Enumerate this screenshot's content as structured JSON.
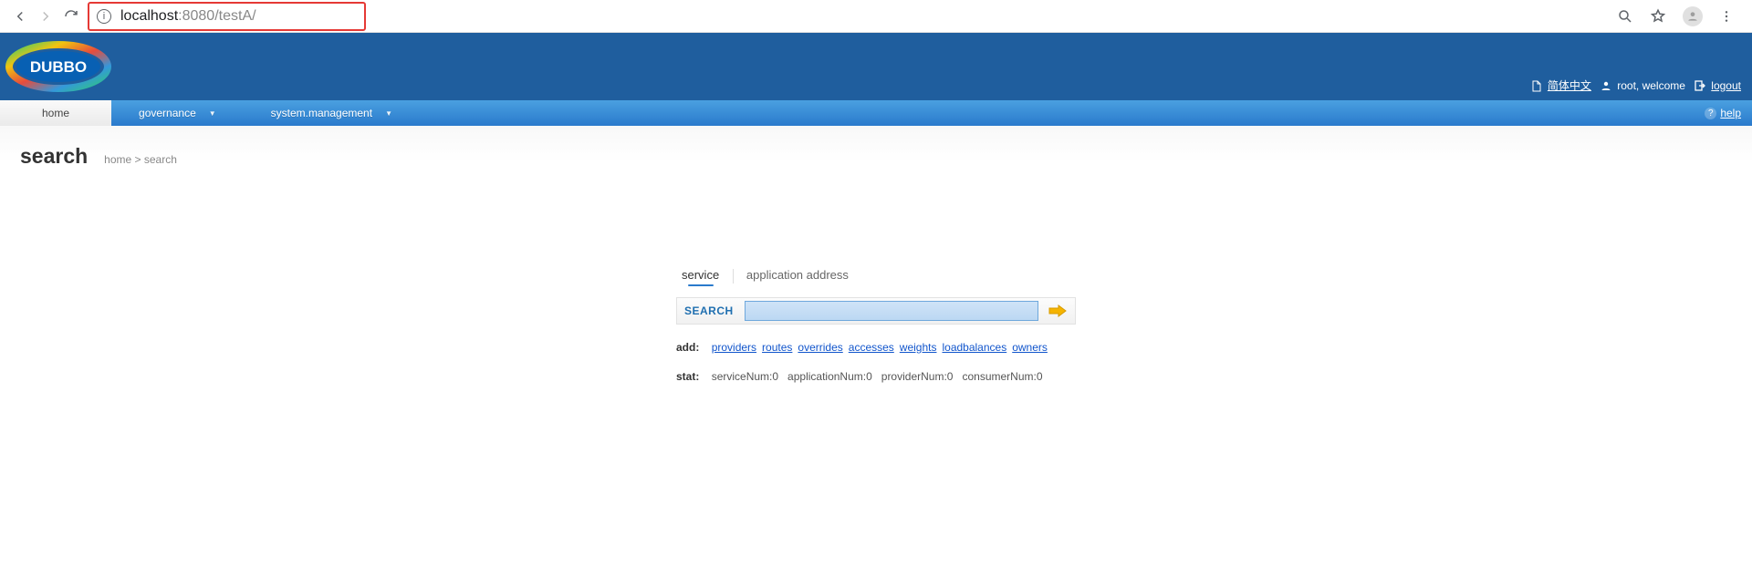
{
  "browser": {
    "url_host": "localhost",
    "url_port": ":8080",
    "url_path": "/testA/"
  },
  "banner": {
    "logo_text": "DUBBO",
    "lang_link": "简体中文",
    "welcome_prefix": "root, ",
    "welcome_word": "welcome",
    "logout": "logout"
  },
  "menu": {
    "home": "home",
    "governance": "governance",
    "sysmgmt": "system.management",
    "help": "help"
  },
  "page": {
    "title": "search",
    "crumb": "home > search"
  },
  "search": {
    "tab_service": "service",
    "tab_appaddr": "application address",
    "button_label": "SEARCH",
    "input_value": ""
  },
  "add": {
    "label": "add:",
    "links": [
      "providers",
      "routes",
      "overrides",
      "accesses",
      "weights",
      "loadbalances",
      "owners"
    ]
  },
  "stat": {
    "label": "stat:",
    "items": [
      "serviceNum:0",
      "applicationNum:0",
      "providerNum:0",
      "consumerNum:0"
    ]
  }
}
